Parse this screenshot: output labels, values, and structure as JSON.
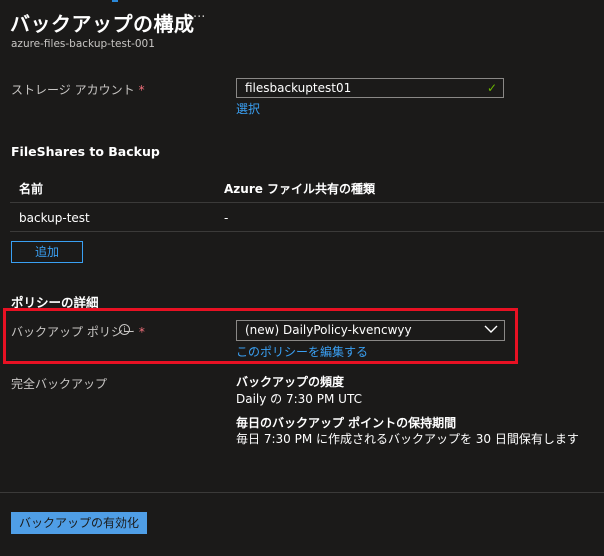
{
  "header": {
    "title": "バックアップの構成",
    "more_label": "···",
    "subtitle": "azure-files-backup-test-001"
  },
  "storage": {
    "label": "ストレージ アカウント",
    "required_mark": "*",
    "value": "filesbackuptest01",
    "select_link": "選択"
  },
  "fileshares": {
    "heading": "FileShares to Backup",
    "columns": [
      "名前",
      "Azure ファイル共有の種類"
    ],
    "rows": [
      [
        "backup-test",
        "-"
      ]
    ],
    "add_button": "追加"
  },
  "policy": {
    "heading": "ポリシーの詳細",
    "label": "バックアップ ポリシー",
    "required_mark": "*",
    "info_icon": "i",
    "selected": "(new) DailyPolicy-kvencwyy",
    "edit_link": "このポリシーを編集する"
  },
  "full_backup": {
    "label": "完全バックアップ",
    "frequency_title": "バックアップの頻度",
    "frequency_value": "Daily の 7:30 PM UTC",
    "retention_title": "毎日のバックアップ ポイントの保持期間",
    "retention_value": "毎日 7:30 PM に作成されるバックアップを 30 日間保有します"
  },
  "footer": {
    "enable_button": "バックアップの有効化"
  },
  "colors": {
    "background": "#1b1a19",
    "accent": "#3aa0f3",
    "highlight": "#e81123",
    "success": "#6bb700"
  }
}
